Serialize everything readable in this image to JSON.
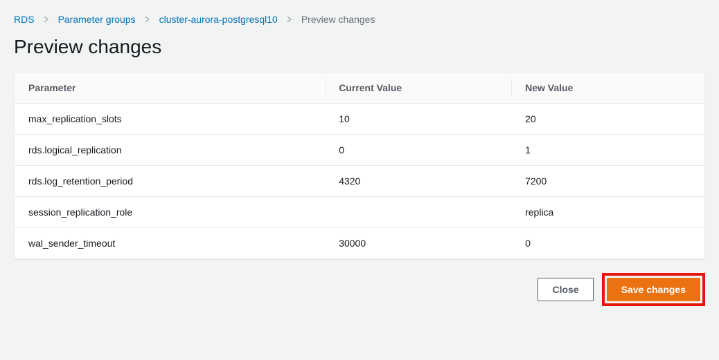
{
  "breadcrumbs": {
    "rds": "RDS",
    "param_groups": "Parameter groups",
    "group_name": "cluster-aurora-postgresql10",
    "current": "Preview changes"
  },
  "page_title": "Preview changes",
  "table": {
    "headers": {
      "parameter": "Parameter",
      "current": "Current Value",
      "new": "New Value"
    },
    "rows": [
      {
        "parameter": "max_replication_slots",
        "current": "10",
        "new": "20"
      },
      {
        "parameter": "rds.logical_replication",
        "current": "0",
        "new": "1"
      },
      {
        "parameter": "rds.log_retention_period",
        "current": "4320",
        "new": "7200"
      },
      {
        "parameter": "session_replication_role",
        "current": "",
        "new": "replica"
      },
      {
        "parameter": "wal_sender_timeout",
        "current": "30000",
        "new": "0"
      }
    ]
  },
  "actions": {
    "close": "Close",
    "save": "Save changes"
  }
}
